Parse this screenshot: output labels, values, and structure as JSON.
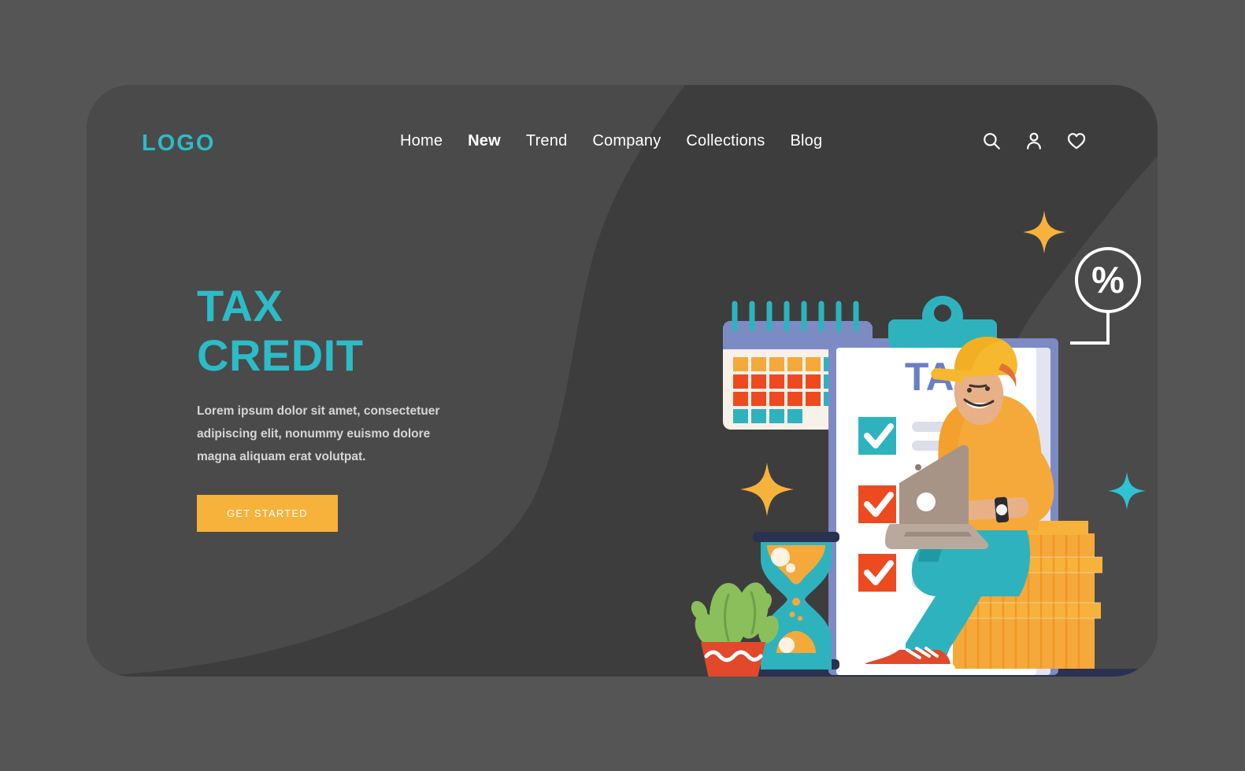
{
  "brand": {
    "logo_text": "LOGO",
    "accent_teal": "#2bbcc8",
    "accent_orange": "#f7b23c",
    "accent_red": "#ed4a20",
    "accent_periwinkle": "#6b7fc7",
    "card_bg": "#3d3d3d",
    "page_bg": "#555555"
  },
  "nav": {
    "items": [
      {
        "label": "Home",
        "active": false
      },
      {
        "label": "New",
        "active": true
      },
      {
        "label": "Trend",
        "active": false
      },
      {
        "label": "Company",
        "active": false
      },
      {
        "label": "Collections",
        "active": false
      },
      {
        "label": "Blog",
        "active": false
      }
    ]
  },
  "header_icons": [
    {
      "name": "search-icon",
      "label": "Search"
    },
    {
      "name": "user-icon",
      "label": "Account"
    },
    {
      "name": "heart-icon",
      "label": "Favorites"
    }
  ],
  "hero": {
    "headline_line1": "TAX",
    "headline_line2": "CREDIT",
    "paragraph": "Lorem ipsum dolor sit amet, consectetuer adipiscing elit, nonummy euismo dolore magna aliquam erat volutpat.",
    "cta_label": "GET STARTED"
  },
  "illustration": {
    "clipboard_title": "TAX",
    "percent_badge": "%",
    "checklist": [
      {
        "state": "checked",
        "color": "#2eb3be"
      },
      {
        "state": "checked",
        "color": "#ed4a20"
      },
      {
        "state": "checked",
        "color": "#ed4a20"
      }
    ],
    "calendar": {
      "row1": [
        "#f5a93a",
        "#f5a93a",
        "#f5a93a",
        "#f5a93a",
        "#f5a93a",
        "#2eb3be",
        "#2eb3be"
      ],
      "row2": [
        "#ed4a20",
        "#ed4a20",
        "#ed4a20",
        "#ed4a20",
        "#ed4a20",
        "#2eb3be",
        "#2eb3be"
      ],
      "row3": [
        "#ed4a20",
        "#ed4a20",
        "#ed4a20",
        "#ed4a20",
        "#ed4a20",
        "#2eb3be",
        "#2eb3be"
      ],
      "row4": [
        "#2eb3be",
        "#2eb3be",
        "#2eb3be",
        "#2eb3be"
      ]
    },
    "objects": [
      "calendar",
      "clipboard",
      "hourglass",
      "potted-plant",
      "coin-stack",
      "person-with-laptop",
      "percent-badge",
      "sparkle-orange",
      "sparkle-teal"
    ]
  }
}
